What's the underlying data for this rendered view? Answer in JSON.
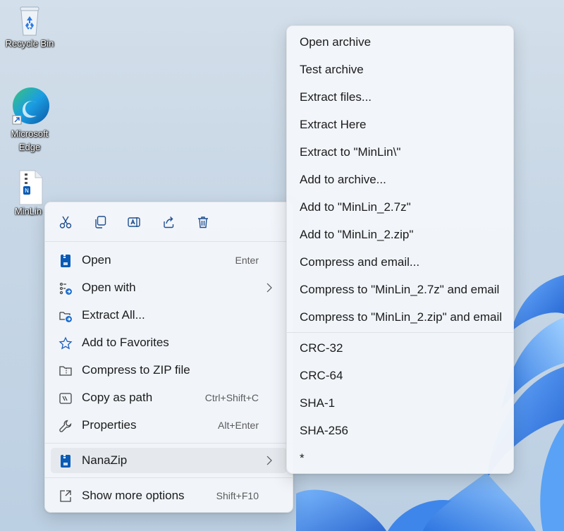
{
  "desktop": {
    "icons": [
      {
        "label": "Recycle Bin",
        "icon": "recycle-bin-icon"
      },
      {
        "label": "Microsoft Edge",
        "icon": "edge-icon"
      },
      {
        "label": "MinLin",
        "icon": "zip-file-icon"
      }
    ]
  },
  "context_menu": {
    "toolbar": [
      {
        "icon": "cut-icon"
      },
      {
        "icon": "copy-icon"
      },
      {
        "icon": "rename-icon"
      },
      {
        "icon": "share-icon"
      },
      {
        "icon": "delete-icon"
      }
    ],
    "items": [
      {
        "label": "Open",
        "shortcut": "Enter",
        "icon": "nanazip-app-icon"
      },
      {
        "label": "Open with",
        "shortcut": "",
        "icon": "open-with-icon",
        "submenu": true
      },
      {
        "label": "Extract All...",
        "shortcut": "",
        "icon": "extract-all-icon"
      },
      {
        "label": "Add to Favorites",
        "shortcut": "",
        "icon": "star-icon"
      },
      {
        "label": "Compress to ZIP file",
        "shortcut": "",
        "icon": "zip-folder-icon"
      },
      {
        "label": "Copy as path",
        "shortcut": "Ctrl+Shift+C",
        "icon": "copy-path-icon"
      },
      {
        "label": "Properties",
        "shortcut": "Alt+Enter",
        "icon": "wrench-icon"
      },
      {
        "label": "NanaZip",
        "shortcut": "",
        "icon": "nanazip-icon",
        "submenu": true,
        "highlighted": true
      },
      {
        "label": "Show more options",
        "shortcut": "Shift+F10",
        "icon": "show-more-options-icon"
      }
    ]
  },
  "nanazip_submenu": {
    "items": [
      "Open archive",
      "Test archive",
      "Extract files...",
      "Extract Here",
      "Extract to \"MinLin\\\"",
      "Add to archive...",
      "Add to \"MinLin_2.7z\"",
      "Add to \"MinLin_2.zip\"",
      "Compress and email...",
      "Compress to \"MinLin_2.7z\" and email",
      "Compress to \"MinLin_2.zip\" and email"
    ],
    "hash_items": [
      "CRC-32",
      "CRC-64",
      "SHA-1",
      "SHA-256",
      "*"
    ]
  },
  "colors": {
    "menu_bg": "#f3f6fa",
    "highlight": "#e5e9ee",
    "accent": "#0a5bb5",
    "wallpaper_bloom": "#2f7fe6"
  }
}
